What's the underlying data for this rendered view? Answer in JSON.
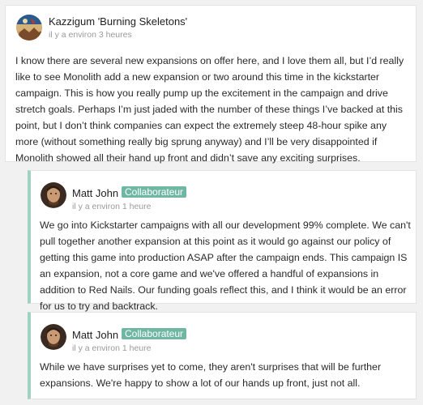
{
  "comments": [
    {
      "author": "Kazzigum 'Burning Skeletons'",
      "role": "",
      "time": "il y a environ 3 heures",
      "text": "I know there are several new expansions on offer here, and I love them all, but I’d really like to see Monolith add a new expansion or two around this time in the kickstarter campaign. This is how you really pump up the excitement in the campaign and drive stretch goals. Perhaps I’m just jaded with the number of these things I’ve backed at this point, but I don’t think companies can expect the extremely steep 48-hour spike any more (without something really big sprung anyway) and I’ll be very disappointed if Monolith showed all their hand up front and didn’t save any exciting surprises."
    },
    {
      "author": "Matt John",
      "role": "Collaborateur",
      "time": "il y a environ 1 heure",
      "text": "We go into Kickstarter campaigns with all our development 99% complete. We can't pull together another expansion at this point as it would go against our policy of getting this game into production ASAP after the campaign ends. This campaign IS an expansion, not a core game and we've offered a handful of expansions in addition to Red Nails. Our funding goals reflect this, and I think it would be an error for us to try and backtrack."
    },
    {
      "author": "Matt John",
      "role": "Collaborateur",
      "time": "il y a environ 1 heure",
      "text": "While we have surprises yet to come, they aren't surprises that will be further expansions. We're happy to show a lot of our hands up front, just not all."
    }
  ],
  "colors": {
    "reply_border": "#9fd1c4",
    "role_badge": "#6fb7a3"
  },
  "icons": {
    "avatar_1": "user-avatar-icon",
    "avatar_2": "user-avatar-icon",
    "avatar_3": "user-avatar-icon"
  }
}
